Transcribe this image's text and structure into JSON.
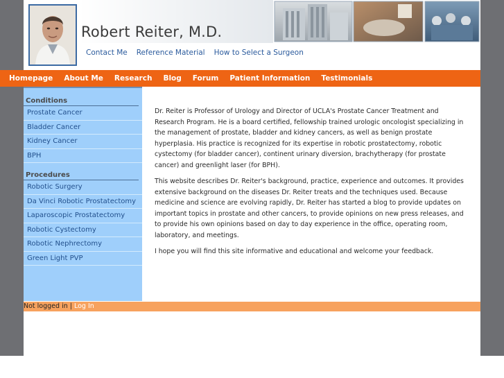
{
  "header": {
    "site_title": "Robert Reiter, M.D.",
    "top_links": [
      "Contact Me",
      "Reference Material",
      "How to Select a Surgeon"
    ]
  },
  "nav": {
    "items": [
      "Homepage",
      "About Me",
      "Research",
      "Blog",
      "Forum",
      "Patient Information",
      "Testimonials"
    ]
  },
  "sidebar": {
    "conditions_heading": "Conditions",
    "conditions": [
      "Prostate Cancer",
      "Bladder Cancer",
      "Kidney Cancer",
      "BPH"
    ],
    "procedures_heading": "Procedures",
    "procedures": [
      "Robotic Surgery",
      "Da Vinci Robotic Prostatectomy",
      "Laparoscopic Prostatectomy",
      "Robotic Cystectomy",
      "Robotic Nephrectomy",
      "Green Light PVP"
    ]
  },
  "content": {
    "paragraphs": [
      "Dr. Reiter is Professor of Urology and Director of UCLA's Prostate Cancer Treatment and Research Program. He is a board certified, fellowship trained  urologic oncologist specializing in the management of prostate, bladder and kidney cancers, as well as benign prostate hyperplasia. His practice is recognized for its expertise in robotic prostatectomy, robotic cystectomy (for bladder cancer), continent urinary diversion, brachytherapy (for prostate cancer) and greenlight laser (for BPH).",
      "This website describes Dr. Reiter's background, practice, experience and outcomes. It provides extensive background on the diseases Dr. Reiter treats and the techniques used. Because medicine and science are evolving rapidly, Dr. Reiter has started a blog to provide updates on important topics in prostate and other cancers, to provide opinions on new press releases, and to provide his own opinions based on day to day experience in the office, operating room, laboratory, and meetings.",
      "I hope you will find this site informative and educational and welcome your feedback."
    ]
  },
  "footer": {
    "status": "Not logged in",
    "separator": " | ",
    "login_link": "Log In"
  },
  "colors": {
    "nav_orange": "#ee6414",
    "sidebar_blue": "#9fcffb",
    "footer_orange": "#f7a25e",
    "page_bg": "#6e6f73",
    "link_blue": "#2a5a9c"
  }
}
